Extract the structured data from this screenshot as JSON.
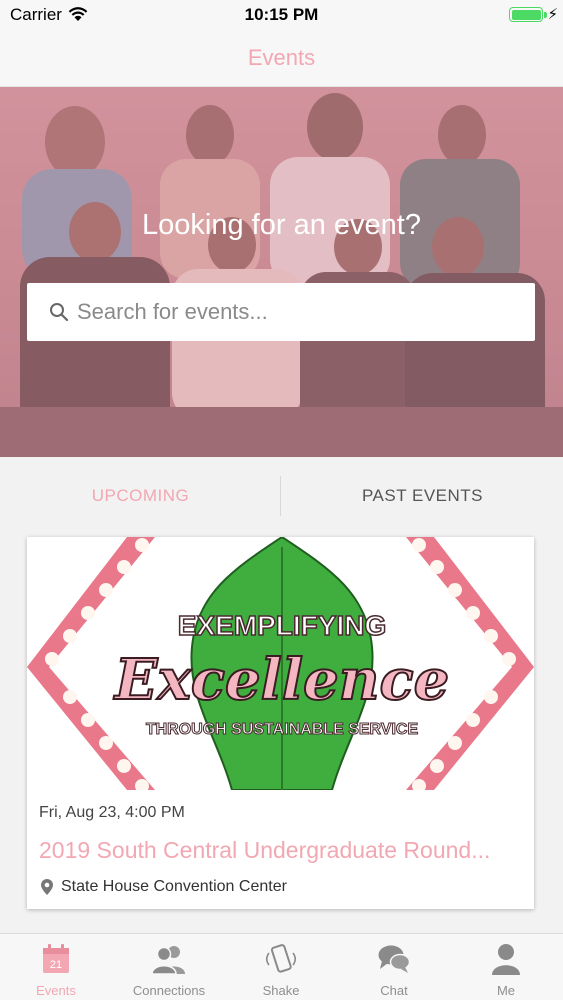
{
  "status_bar": {
    "carrier": "Carrier",
    "time": "10:15 PM",
    "battery_level": 1.0
  },
  "nav": {
    "title": "Events"
  },
  "hero": {
    "title": "Looking for an event?",
    "search_placeholder": "Search for events..."
  },
  "tabs": [
    {
      "label": "UPCOMING",
      "active": true
    },
    {
      "label": "PAST EVENTS",
      "active": false
    }
  ],
  "events": [
    {
      "banner_line1": "EXEMPLIFYING",
      "banner_line2": "Excellence",
      "banner_line3": "THROUGH SUSTAINABLE SERVICE",
      "date": "Fri, Aug 23, 4:00 PM",
      "title": "2019 South Central Undergraduate Round...",
      "location": "State House Convention Center",
      "location_icon": "map-pin-icon"
    }
  ],
  "tab_bar": {
    "items": [
      {
        "label": "Events",
        "icon": "calendar-icon",
        "active": true,
        "calendar_day": "21"
      },
      {
        "label": "Connections",
        "icon": "people-icon",
        "active": false
      },
      {
        "label": "Shake",
        "icon": "shake-phone-icon",
        "active": false
      },
      {
        "label": "Chat",
        "icon": "chat-bubbles-icon",
        "active": false
      },
      {
        "label": "Me",
        "icon": "person-icon",
        "active": false
      }
    ]
  },
  "colors": {
    "accent": "#f2a7b2",
    "leaf_green": "#3fae3f",
    "marquee_pink": "#e8788a"
  }
}
